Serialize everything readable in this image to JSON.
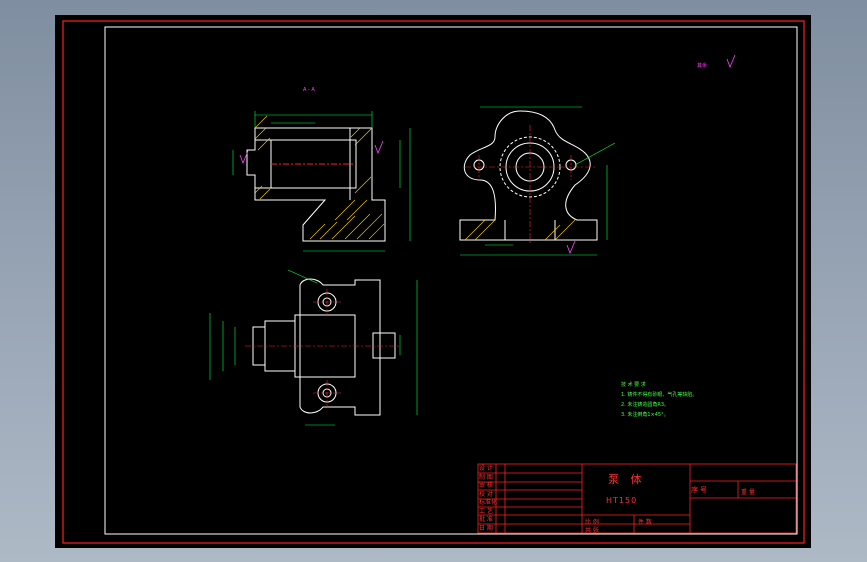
{
  "title_block": {
    "part_name": "泵 体",
    "material": "HT150",
    "drawing_no_label": "序号",
    "scale_label": "比 例",
    "quantity_label": "件 数",
    "sheet_label": "共 张",
    "left_rows": [
      "设 计",
      "制 图",
      "审 核",
      "校 对",
      "标准化",
      "工 艺",
      "批 准",
      "日 期"
    ],
    "weight_label": "重 量"
  },
  "tech_requirements": {
    "heading": "技 术 要 求",
    "items": [
      "1. 铸件不得有砂眼、气孔等缺陷。",
      "2. 未注铸造圆角R3。",
      "3. 未注倒角1×45°。"
    ]
  },
  "annotations": {
    "section_mark": "A - A",
    "roughness_mark": "其余"
  },
  "colors": {
    "frame": "#ff2020",
    "outline": "#ffffff",
    "dimension": "#00ff40",
    "centerline": "#ff2020",
    "hatch": "#ffd000",
    "annotation": "#ff40ff",
    "background": "#000000"
  }
}
